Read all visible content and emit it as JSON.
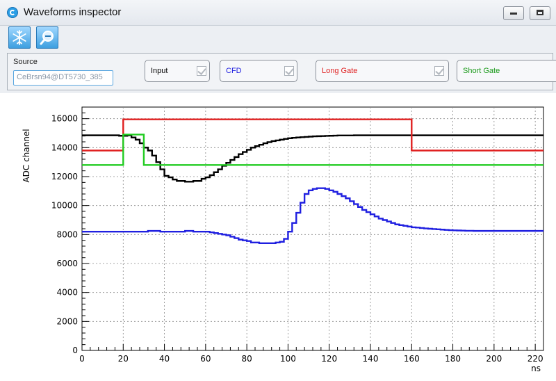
{
  "window": {
    "title": "Waveforms inspector"
  },
  "toolbar": {
    "tools": [
      {
        "icon": "snowflake-icon"
      },
      {
        "icon": "zoom-out-icon"
      }
    ]
  },
  "controls": {
    "source_label": "Source",
    "source_value": "CeBrsn94@DT5730_385",
    "checkboxes": [
      {
        "label": "Input",
        "color": "#000000"
      },
      {
        "label": "CFD",
        "color": "#1f1fe0"
      },
      {
        "label": "Long Gate",
        "color": "#e02020"
      },
      {
        "label": "Short Gate",
        "color": "#1a9a1a"
      }
    ]
  },
  "chart_data": {
    "type": "line",
    "step": true,
    "xlabel": "ns",
    "ylabel": "ADC channel",
    "xlim": [
      0,
      224
    ],
    "ylim": [
      0,
      16800
    ],
    "xticks": [
      0,
      20,
      40,
      60,
      80,
      100,
      120,
      140,
      160,
      180,
      200,
      220
    ],
    "yticks": [
      0,
      2000,
      4000,
      6000,
      8000,
      10000,
      12000,
      14000,
      16000
    ],
    "grid": true,
    "series": [
      {
        "color": "#000000",
        "x": [
          0,
          2,
          4,
          6,
          8,
          10,
          12,
          14,
          16,
          18,
          20,
          22,
          24,
          26,
          28,
          30,
          32,
          34,
          36,
          38,
          40,
          42,
          44,
          46,
          48,
          50,
          52,
          54,
          56,
          58,
          60,
          62,
          64,
          66,
          68,
          70,
          72,
          74,
          76,
          78,
          80,
          82,
          84,
          86,
          88,
          90,
          92,
          94,
          96,
          98,
          100,
          102,
          104,
          106,
          108,
          110,
          112,
          114,
          116,
          118,
          120,
          122,
          124,
          126,
          128,
          130,
          132,
          134,
          136,
          138,
          140,
          142,
          144,
          146,
          148,
          150,
          152,
          154,
          156,
          158,
          160,
          162,
          164,
          166,
          168,
          170,
          172,
          174,
          176,
          178,
          180,
          182,
          184,
          186,
          188,
          190,
          192,
          194,
          196,
          198,
          200,
          202,
          204,
          206,
          208,
          210,
          212,
          214,
          216,
          218,
          220,
          222,
          224
        ],
        "y": [
          14850,
          14850,
          14850,
          14850,
          14850,
          14850,
          14850,
          14850,
          14850,
          14820,
          14820,
          14850,
          14700,
          14550,
          14300,
          14000,
          13800,
          13450,
          13000,
          12500,
          12050,
          11950,
          11800,
          11700,
          11700,
          11650,
          11650,
          11700,
          11700,
          11850,
          11950,
          12100,
          12300,
          12500,
          12750,
          12950,
          13150,
          13350,
          13550,
          13700,
          13850,
          14000,
          14100,
          14200,
          14300,
          14380,
          14450,
          14500,
          14550,
          14600,
          14650,
          14680,
          14700,
          14720,
          14740,
          14760,
          14780,
          14790,
          14800,
          14810,
          14820,
          14830,
          14840,
          14840,
          14840,
          14840,
          14850,
          14850,
          14850,
          14850,
          14850,
          14850,
          14850,
          14850,
          14850,
          14850,
          14850,
          14850,
          14850,
          14850,
          14850,
          14850,
          14850,
          14850,
          14850,
          14850,
          14850,
          14850,
          14850,
          14850,
          14850,
          14850,
          14850,
          14850,
          14850,
          14850,
          14850,
          14850,
          14850,
          14850,
          14850,
          14850,
          14850,
          14850,
          14850,
          14850,
          14850,
          14850,
          14850,
          14850,
          14850,
          14850,
          14850
        ]
      },
      {
        "color": "#1f1fe0",
        "x": [
          0,
          2,
          4,
          6,
          8,
          10,
          12,
          14,
          16,
          18,
          20,
          22,
          24,
          26,
          28,
          30,
          32,
          34,
          36,
          38,
          40,
          42,
          44,
          46,
          48,
          50,
          52,
          54,
          56,
          58,
          60,
          62,
          64,
          66,
          68,
          70,
          72,
          74,
          76,
          78,
          80,
          82,
          84,
          86,
          88,
          90,
          92,
          94,
          96,
          98,
          100,
          102,
          104,
          106,
          108,
          110,
          112,
          114,
          116,
          118,
          120,
          122,
          124,
          126,
          128,
          130,
          132,
          134,
          136,
          138,
          140,
          142,
          144,
          146,
          148,
          150,
          152,
          154,
          156,
          158,
          160,
          162,
          164,
          166,
          168,
          170,
          172,
          174,
          176,
          178,
          180,
          182,
          184,
          186,
          188,
          190,
          192,
          194,
          196,
          198,
          200,
          202,
          204,
          206,
          208,
          210,
          212,
          214,
          216,
          218,
          220,
          222,
          224
        ],
        "y": [
          8200,
          8200,
          8200,
          8200,
          8200,
          8200,
          8200,
          8200,
          8200,
          8200,
          8200,
          8200,
          8200,
          8200,
          8200,
          8200,
          8250,
          8250,
          8250,
          8200,
          8200,
          8200,
          8200,
          8200,
          8200,
          8250,
          8250,
          8200,
          8200,
          8200,
          8200,
          8150,
          8100,
          8050,
          8000,
          7950,
          7850,
          7750,
          7650,
          7600,
          7550,
          7450,
          7450,
          7400,
          7400,
          7400,
          7400,
          7450,
          7500,
          7700,
          8200,
          8800,
          9500,
          10200,
          10800,
          11050,
          11150,
          11200,
          11200,
          11150,
          11050,
          10950,
          10800,
          10650,
          10500,
          10300,
          10100,
          9900,
          9700,
          9550,
          9400,
          9250,
          9100,
          9000,
          8900,
          8800,
          8700,
          8650,
          8600,
          8550,
          8500,
          8480,
          8450,
          8420,
          8400,
          8380,
          8360,
          8340,
          8320,
          8300,
          8290,
          8280,
          8270,
          8260,
          8260,
          8250,
          8250,
          8250,
          8250,
          8250,
          8250,
          8250,
          8250,
          8250,
          8250,
          8250,
          8250,
          8250,
          8250,
          8250,
          8250,
          8250,
          8250
        ]
      },
      {
        "color": "#e02020",
        "x": [
          0,
          20,
          20,
          160,
          160,
          224
        ],
        "y": [
          13800,
          13800,
          15950,
          15950,
          13800,
          13800
        ]
      },
      {
        "color": "#22cc22",
        "x": [
          0,
          20,
          20,
          30,
          30,
          224
        ],
        "y": [
          12800,
          12800,
          14900,
          14900,
          12800,
          12800
        ]
      }
    ]
  }
}
